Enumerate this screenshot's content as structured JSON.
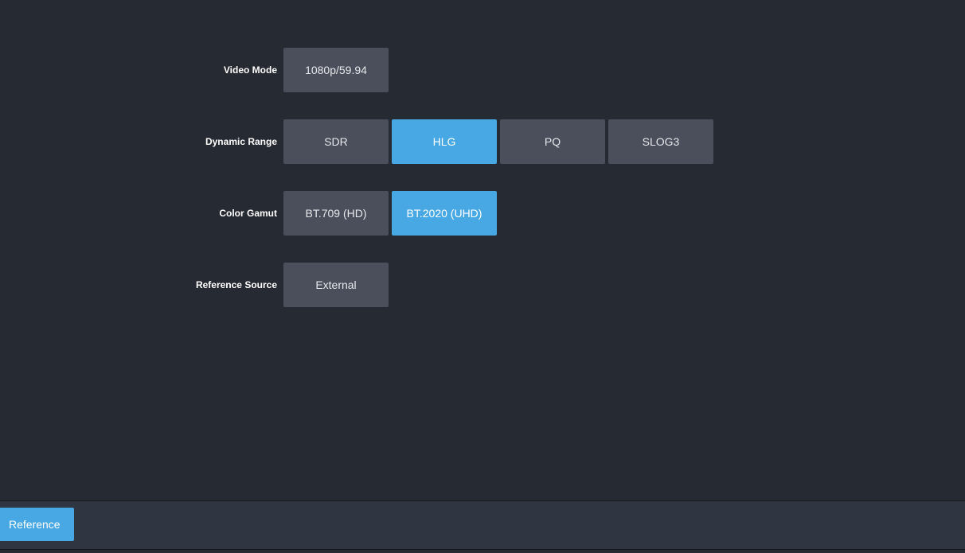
{
  "settings": {
    "video_mode": {
      "label": "Video Mode",
      "options": [
        "1080p/59.94"
      ],
      "selected": "1080p/59.94"
    },
    "dynamic_range": {
      "label": "Dynamic Range",
      "options": [
        "SDR",
        "HLG",
        "PQ",
        "SLOG3"
      ],
      "selected": "HLG"
    },
    "color_gamut": {
      "label": "Color Gamut",
      "options": [
        "BT.709 (HD)",
        "BT.2020 (UHD)"
      ],
      "selected": "BT.2020 (UHD)"
    },
    "reference_source": {
      "label": "Reference Source",
      "options": [
        "External"
      ],
      "selected": "External"
    }
  },
  "footer": {
    "tabs": [
      {
        "label": "Reference",
        "active": true
      }
    ]
  },
  "colors": {
    "background": "#262a32",
    "button": "#4a4f5b",
    "accent": "#47a8e3",
    "footer": "#2f3541"
  }
}
